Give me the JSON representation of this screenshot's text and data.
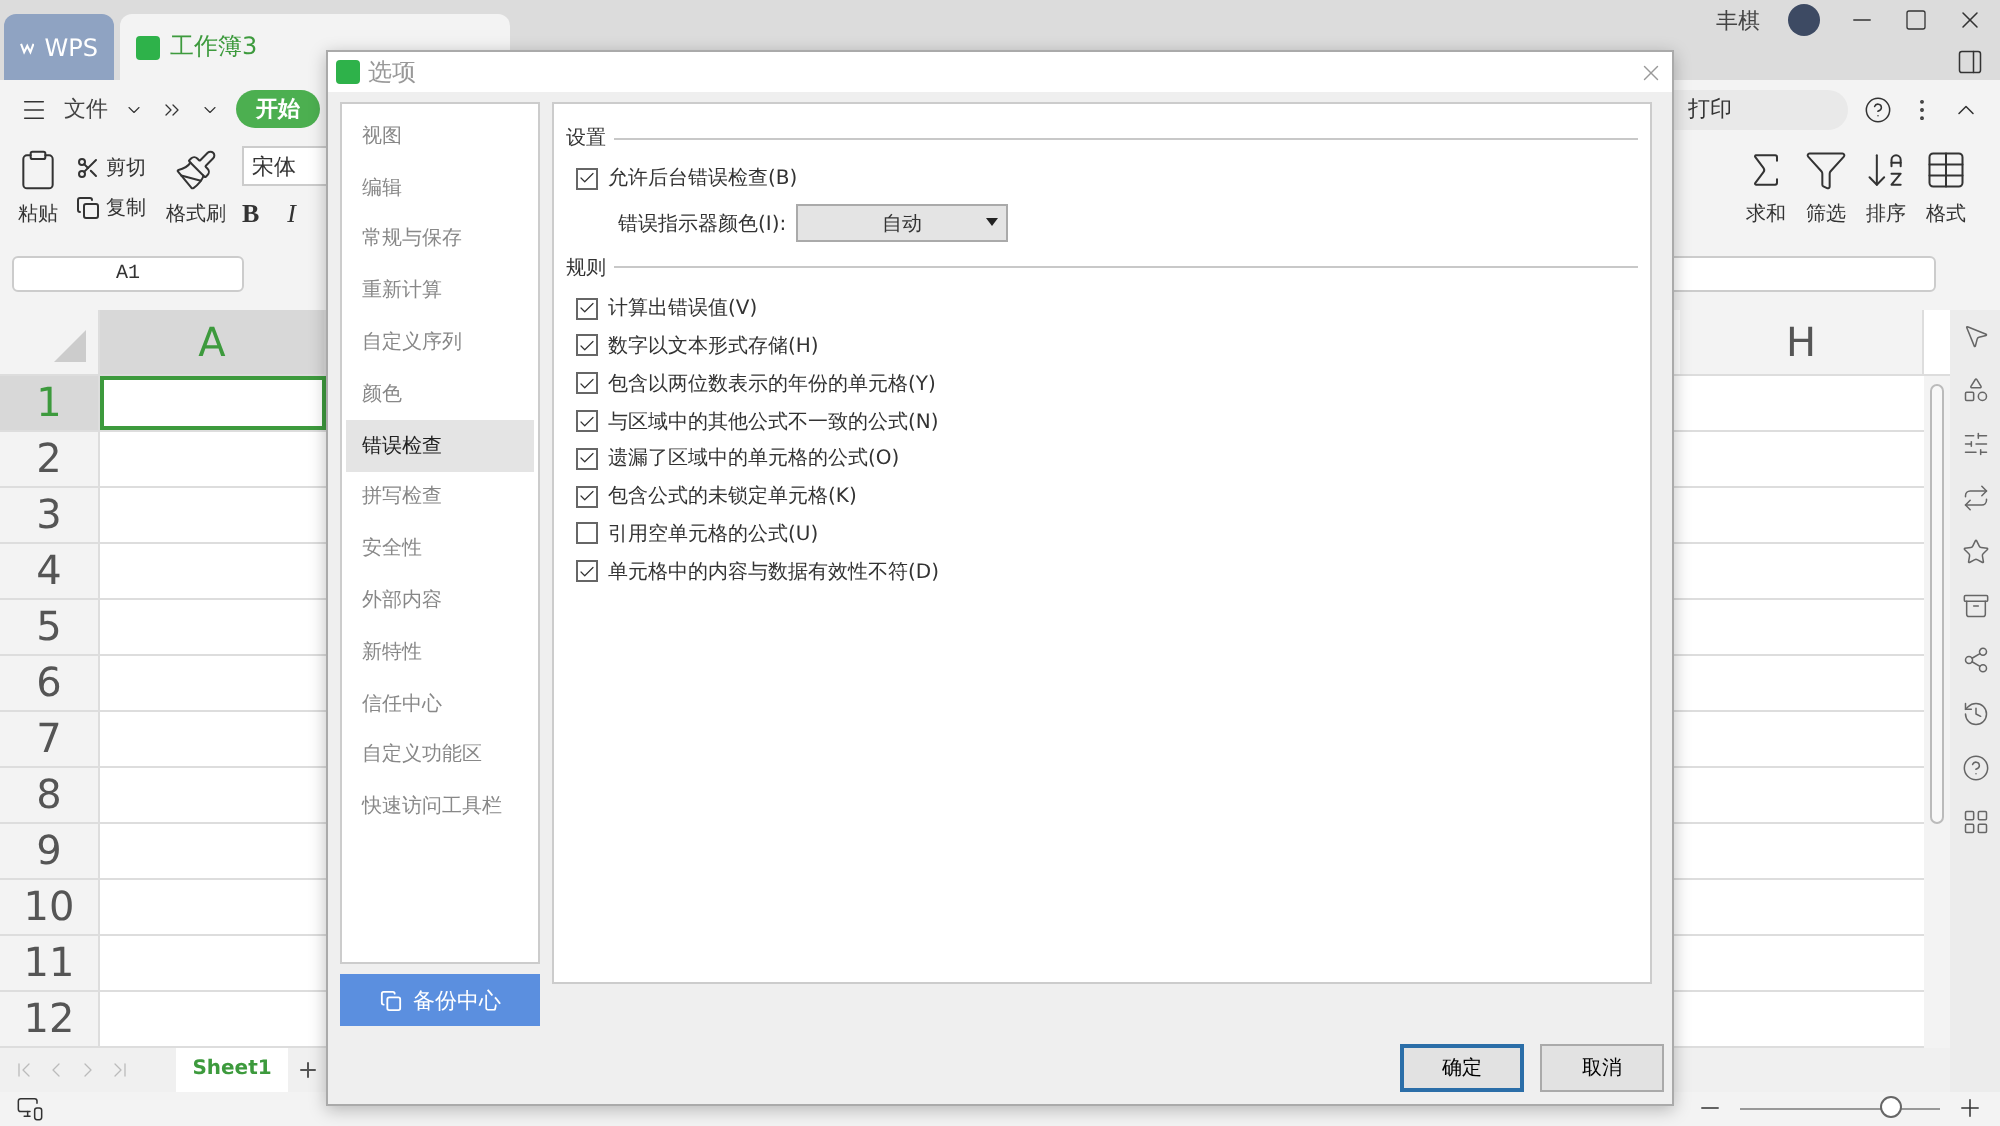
{
  "titlebar": {
    "tabs": [
      {
        "label": "WPS",
        "selected": false
      },
      {
        "label": "工作簿3",
        "selected": true
      }
    ],
    "user": "丰棋"
  },
  "menu": {
    "file": "文件",
    "start": "开始",
    "search": "打印"
  },
  "ribbon": {
    "left": [
      {
        "kind": "big",
        "label": "粘贴"
      },
      {
        "kind": "small",
        "label": "剪切"
      },
      {
        "kind": "small",
        "label": "复制"
      },
      {
        "kind": "big",
        "label": "格式刷"
      }
    ],
    "font": "宋体",
    "bold": "B",
    "italic": "I",
    "right": [
      {
        "label": "求和"
      },
      {
        "label": "筛选"
      },
      {
        "label": "排序"
      },
      {
        "label": "格式"
      }
    ]
  },
  "name_box": "A1",
  "sheet": {
    "columns": [
      "A",
      "H"
    ],
    "rows": [
      {
        "label": "1",
        "selected": true
      },
      {
        "label": "2",
        "selected": false
      },
      {
        "label": "3",
        "selected": false
      },
      {
        "label": "4",
        "selected": false
      },
      {
        "label": "5",
        "selected": false
      },
      {
        "label": "6",
        "selected": false
      },
      {
        "label": "7",
        "selected": false
      },
      {
        "label": "8",
        "selected": false
      },
      {
        "label": "9",
        "selected": false
      },
      {
        "label": "10",
        "selected": false
      },
      {
        "label": "11",
        "selected": false
      },
      {
        "label": "12",
        "selected": false
      }
    ]
  },
  "sheet_tab": "Sheet1",
  "zoom": {
    "level": 0.75
  },
  "dialog": {
    "title": "选项",
    "nav": [
      {
        "label": "视图",
        "selected": false
      },
      {
        "label": "编辑",
        "selected": false
      },
      {
        "label": "常规与保存",
        "selected": false
      },
      {
        "label": "重新计算",
        "selected": false
      },
      {
        "label": "自定义序列",
        "selected": false
      },
      {
        "label": "颜色",
        "selected": false
      },
      {
        "label": "错误检查",
        "selected": true
      },
      {
        "label": "拼写检查",
        "selected": false
      },
      {
        "label": "安全性",
        "selected": false
      },
      {
        "label": "外部内容",
        "selected": false
      },
      {
        "label": "新特性",
        "selected": false
      },
      {
        "label": "信任中心",
        "selected": false
      },
      {
        "label": "自定义功能区",
        "selected": false
      },
      {
        "label": "快速访问工具栏",
        "selected": false
      }
    ],
    "backup": "备份中心",
    "settings": {
      "heading": "设置",
      "allow": {
        "label": "允许后台错误检查(B)",
        "checked": true
      },
      "color_label": "错误指示器颜色(I):",
      "color_value": "自动"
    },
    "rules": {
      "heading": "规则",
      "items": [
        {
          "label": "计算出错误值(V)",
          "checked": true
        },
        {
          "label": "数字以文本形式存储(H)",
          "checked": true
        },
        {
          "label": "包含以两位数表示的年份的单元格(Y)",
          "checked": true
        },
        {
          "label": "与区域中的其他公式不一致的公式(N)",
          "checked": true
        },
        {
          "label": "遗漏了区域中的单元格的公式(O)",
          "checked": true
        },
        {
          "label": "包含公式的未锁定单元格(K)",
          "checked": true
        },
        {
          "label": "引用空单元格的公式(U)",
          "checked": false
        },
        {
          "label": "单元格中的内容与数据有效性不符(D)",
          "checked": true
        }
      ]
    },
    "buttons": [
      {
        "label": "确定",
        "kind": "primary"
      },
      {
        "label": "取消",
        "kind": "secondary"
      }
    ]
  }
}
